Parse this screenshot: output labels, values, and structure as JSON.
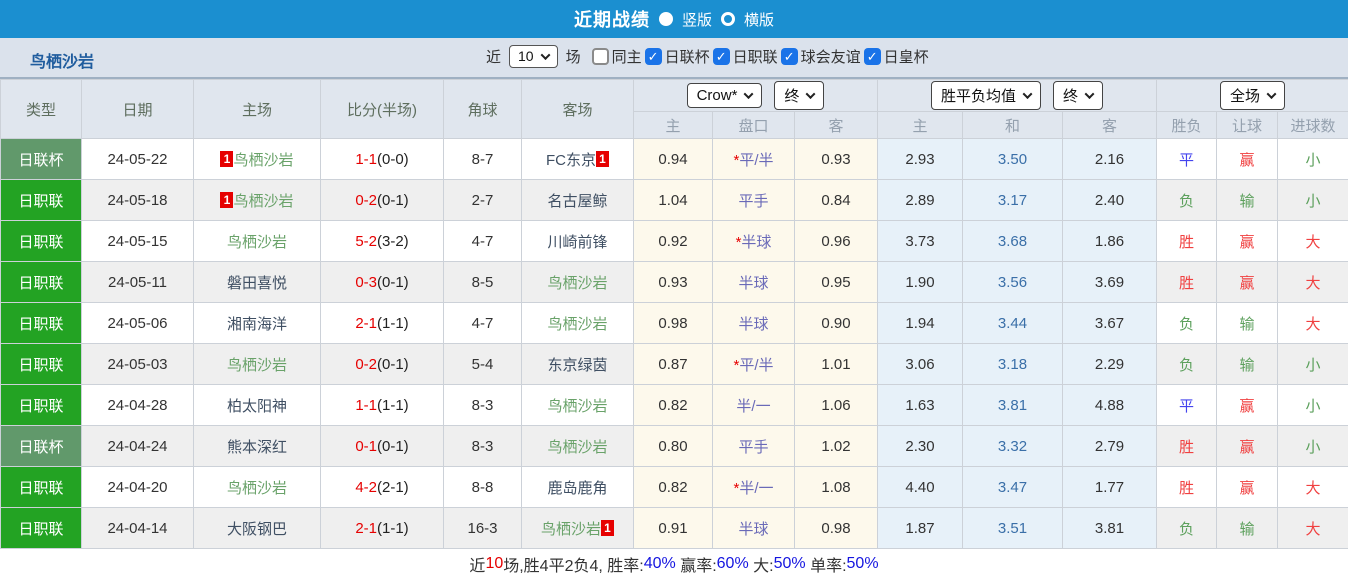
{
  "titlebar": {
    "title": "近期战绩",
    "vertical_label": "竖版",
    "horizontal_label": "横版",
    "selected_layout": "竖版"
  },
  "filterbar": {
    "team": "鸟栖沙岩",
    "near_label": "近",
    "count": "10",
    "games_label": "场",
    "same_home_label": "同主",
    "same_home_checked": false,
    "leagues": [
      "日联杯",
      "日职联",
      "球会友谊",
      "日皇杯"
    ],
    "leagues_checked": [
      true,
      true,
      true,
      true
    ]
  },
  "colors": {
    "topbar_blue": "#1b8fd0",
    "checkbox_blue": "#1a73e8",
    "league_green": "#23a323",
    "cup_green": "#61996b",
    "red_card_badge": "#e60000",
    "focus_team_green": "#69a269",
    "asia_odds_bg": "#fdf9ec",
    "euro_odds_bg": "#e7f1f9"
  },
  "table": {
    "headers": {
      "type": "类型",
      "date": "日期",
      "home": "主场",
      "score": "比分(半场)",
      "corners": "角球",
      "away": "客场"
    },
    "group_asia": {
      "source_select": "Crow*",
      "time_select": "终"
    },
    "group_eu": {
      "type_select": "胜平负均值",
      "time_select": "终"
    },
    "group_full": {
      "scope_select": "全场"
    },
    "sub": {
      "asia_home": "主",
      "asia_handicap": "盘口",
      "asia_away": "客",
      "eu_home": "主",
      "eu_draw": "和",
      "eu_away": "客",
      "res_wdl": "胜负",
      "res_handicap": "让球",
      "res_goals": "进球数"
    },
    "rows": [
      {
        "type": "日联杯",
        "style": "cup",
        "date": "24-05-22",
        "home": "鸟栖沙岩",
        "home_badge": "1",
        "home_focus": true,
        "score": "1-1",
        "half": "(0-0)",
        "corners": "8-7",
        "away": "FC东京",
        "away_badge": "1",
        "away_focus": false,
        "asia_home": "0.94",
        "handicap_star": true,
        "handicap": "平/半",
        "asia_away": "0.93",
        "eu_home": "2.93",
        "eu_draw": "3.50",
        "eu_away": "2.16",
        "res_wdl": {
          "t": "平",
          "c": "blue"
        },
        "res_handicap": {
          "t": "赢",
          "c": "red"
        },
        "res_goals": {
          "t": "小",
          "c": "green"
        }
      },
      {
        "type": "日职联",
        "style": "league",
        "date": "24-05-18",
        "home": "鸟栖沙岩",
        "home_badge": "1",
        "home_focus": true,
        "score": "0-2",
        "half": "(0-1)",
        "corners": "2-7",
        "away": "名古屋鲸",
        "away_badge": null,
        "away_focus": false,
        "asia_home": "1.04",
        "handicap_star": false,
        "handicap": "平手",
        "asia_away": "0.84",
        "eu_home": "2.89",
        "eu_draw": "3.17",
        "eu_away": "2.40",
        "res_wdl": {
          "t": "负",
          "c": "green"
        },
        "res_handicap": {
          "t": "输",
          "c": "green"
        },
        "res_goals": {
          "t": "小",
          "c": "green"
        }
      },
      {
        "type": "日职联",
        "style": "league",
        "date": "24-05-15",
        "home": "鸟栖沙岩",
        "home_badge": null,
        "home_focus": true,
        "score": "5-2",
        "half": "(3-2)",
        "corners": "4-7",
        "away": "川崎前锋",
        "away_badge": null,
        "away_focus": false,
        "asia_home": "0.92",
        "handicap_star": true,
        "handicap": "半球",
        "asia_away": "0.96",
        "eu_home": "3.73",
        "eu_draw": "3.68",
        "eu_away": "1.86",
        "res_wdl": {
          "t": "胜",
          "c": "red"
        },
        "res_handicap": {
          "t": "赢",
          "c": "red"
        },
        "res_goals": {
          "t": "大",
          "c": "red"
        }
      },
      {
        "type": "日职联",
        "style": "league",
        "date": "24-05-11",
        "home": "磐田喜悦",
        "home_badge": null,
        "home_focus": false,
        "score": "0-3",
        "half": "(0-1)",
        "corners": "8-5",
        "away": "鸟栖沙岩",
        "away_badge": null,
        "away_focus": true,
        "asia_home": "0.93",
        "handicap_star": false,
        "handicap": "半球",
        "asia_away": "0.95",
        "eu_home": "1.90",
        "eu_draw": "3.56",
        "eu_away": "3.69",
        "res_wdl": {
          "t": "胜",
          "c": "red"
        },
        "res_handicap": {
          "t": "赢",
          "c": "red"
        },
        "res_goals": {
          "t": "大",
          "c": "red"
        }
      },
      {
        "type": "日职联",
        "style": "league",
        "date": "24-05-06",
        "home": "湘南海洋",
        "home_badge": null,
        "home_focus": false,
        "score": "2-1",
        "half": "(1-1)",
        "corners": "4-7",
        "away": "鸟栖沙岩",
        "away_badge": null,
        "away_focus": true,
        "asia_home": "0.98",
        "handicap_star": false,
        "handicap": "半球",
        "asia_away": "0.90",
        "eu_home": "1.94",
        "eu_draw": "3.44",
        "eu_away": "3.67",
        "res_wdl": {
          "t": "负",
          "c": "green"
        },
        "res_handicap": {
          "t": "输",
          "c": "green"
        },
        "res_goals": {
          "t": "大",
          "c": "red"
        }
      },
      {
        "type": "日职联",
        "style": "league",
        "date": "24-05-03",
        "home": "鸟栖沙岩",
        "home_badge": null,
        "home_focus": true,
        "score": "0-2",
        "half": "(0-1)",
        "corners": "5-4",
        "away": "东京绿茵",
        "away_badge": null,
        "away_focus": false,
        "asia_home": "0.87",
        "handicap_star": true,
        "handicap": "平/半",
        "asia_away": "1.01",
        "eu_home": "3.06",
        "eu_draw": "3.18",
        "eu_away": "2.29",
        "res_wdl": {
          "t": "负",
          "c": "green"
        },
        "res_handicap": {
          "t": "输",
          "c": "green"
        },
        "res_goals": {
          "t": "小",
          "c": "green"
        }
      },
      {
        "type": "日职联",
        "style": "league",
        "date": "24-04-28",
        "home": "柏太阳神",
        "home_badge": null,
        "home_focus": false,
        "score": "1-1",
        "half": "(1-1)",
        "corners": "8-3",
        "away": "鸟栖沙岩",
        "away_badge": null,
        "away_focus": true,
        "asia_home": "0.82",
        "handicap_star": false,
        "handicap": "半/一",
        "asia_away": "1.06",
        "eu_home": "1.63",
        "eu_draw": "3.81",
        "eu_away": "4.88",
        "res_wdl": {
          "t": "平",
          "c": "blue"
        },
        "res_handicap": {
          "t": "赢",
          "c": "red"
        },
        "res_goals": {
          "t": "小",
          "c": "green"
        }
      },
      {
        "type": "日联杯",
        "style": "cup",
        "date": "24-04-24",
        "home": "熊本深红",
        "home_badge": null,
        "home_focus": false,
        "score": "0-1",
        "half": "(0-1)",
        "corners": "8-3",
        "away": "鸟栖沙岩",
        "away_badge": null,
        "away_focus": true,
        "asia_home": "0.80",
        "handicap_star": false,
        "handicap": "平手",
        "asia_away": "1.02",
        "eu_home": "2.30",
        "eu_draw": "3.32",
        "eu_away": "2.79",
        "res_wdl": {
          "t": "胜",
          "c": "red"
        },
        "res_handicap": {
          "t": "赢",
          "c": "red"
        },
        "res_goals": {
          "t": "小",
          "c": "green"
        }
      },
      {
        "type": "日职联",
        "style": "league",
        "date": "24-04-20",
        "home": "鸟栖沙岩",
        "home_badge": null,
        "home_focus": true,
        "score": "4-2",
        "half": "(2-1)",
        "corners": "8-8",
        "away": "鹿岛鹿角",
        "away_badge": null,
        "away_focus": false,
        "asia_home": "0.82",
        "handicap_star": true,
        "handicap": "半/一",
        "asia_away": "1.08",
        "eu_home": "4.40",
        "eu_draw": "3.47",
        "eu_away": "1.77",
        "res_wdl": {
          "t": "胜",
          "c": "red"
        },
        "res_handicap": {
          "t": "赢",
          "c": "red"
        },
        "res_goals": {
          "t": "大",
          "c": "red"
        }
      },
      {
        "type": "日职联",
        "style": "league",
        "date": "24-04-14",
        "home": "大阪钢巴",
        "home_badge": null,
        "home_focus": false,
        "score": "2-1",
        "half": "(1-1)",
        "corners": "16-3",
        "away": "鸟栖沙岩",
        "away_badge": "1",
        "away_focus": true,
        "asia_home": "0.91",
        "handicap_star": false,
        "handicap": "半球",
        "asia_away": "0.98",
        "eu_home": "1.87",
        "eu_draw": "3.51",
        "eu_away": "3.81",
        "res_wdl": {
          "t": "负",
          "c": "green"
        },
        "res_handicap": {
          "t": "输",
          "c": "green"
        },
        "res_goals": {
          "t": "大",
          "c": "red"
        }
      }
    ]
  },
  "summary": {
    "segments": [
      {
        "t": "近",
        "c": "dark"
      },
      {
        "t": "10",
        "c": "red"
      },
      {
        "t": "场,胜4平2负4, 胜率:",
        "c": "dark"
      },
      {
        "t": "40%",
        "c": "blue"
      },
      {
        "t": " 赢率:",
        "c": "dark"
      },
      {
        "t": "60%",
        "c": "blue"
      },
      {
        "t": " 大:",
        "c": "dark"
      },
      {
        "t": "50%",
        "c": "blue"
      },
      {
        "t": " 单率:",
        "c": "dark"
      },
      {
        "t": "50%",
        "c": "blue"
      }
    ]
  }
}
